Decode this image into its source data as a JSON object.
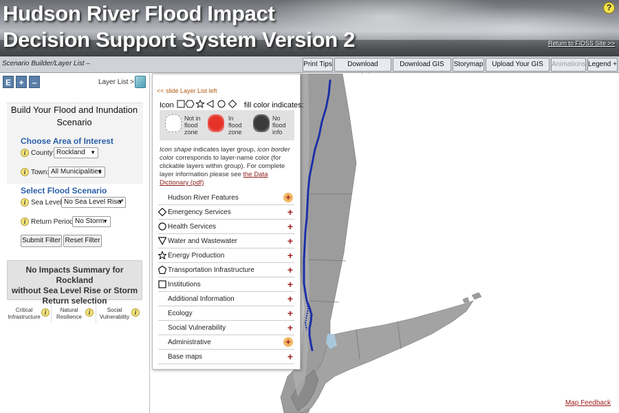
{
  "header": {
    "title_line1": "Hudson River Flood Impact",
    "title_line2": "Decision Support System Version 2",
    "return_link": "Return to FIDSS Site >>",
    "help_icon": "?"
  },
  "toolbar": {
    "scenario_toggle": "Scenario Builder/Layer List –",
    "buttons": [
      "Print Tips",
      "Download Statistics",
      "Download GIS Data",
      "Storymap",
      "Upload Your GIS Data",
      "Animations"
    ],
    "legend": "Legend +"
  },
  "left_panel": {
    "ctrl_buttons": [
      "E",
      "+",
      "–"
    ],
    "layer_list_link": "Layer List >>",
    "build_title_line1": "Build Your Flood and Inundation",
    "build_title_line2": "Scenario",
    "area_head": "Choose Area of Interest",
    "county_label": "County:",
    "county_value": "Rockland",
    "town_label": "Town:",
    "town_value": "All Municipalities",
    "flood_head": "Select Flood Scenario",
    "sea_level_label": "Sea Level:",
    "sea_level_value": "No Sea Level Rise*",
    "return_period_label": "Return Period:",
    "return_period_value": "No Storm",
    "submit_label": "Submit Filter",
    "reset_label": "Reset Filter",
    "summary_line1": "No Impacts Summary for Rockland",
    "summary_line2": "without Sea Level Rise or Storm",
    "summary_line3": "Return selection",
    "summary_tabs": [
      {
        "line1": "Critical",
        "line2": "Infrastructure"
      },
      {
        "line1": "Natural",
        "line2": "Resilience"
      },
      {
        "line1": "Social",
        "line2": "Vulnerability"
      }
    ]
  },
  "layer_panel": {
    "slide_link": "<< slide Layer List left",
    "icon_label": "Icon",
    "fill_label": "fill color indicates:",
    "legend_items": [
      {
        "line1": "Not in",
        "line2": "flood",
        "line3": "zone",
        "color": "#ffffff"
      },
      {
        "line1": "In",
        "line2": "flood",
        "line3": "zone",
        "color": "#e5332a"
      },
      {
        "line1": "No",
        "line2": "flood",
        "line3": "info",
        "color": "#3a3a3a"
      }
    ],
    "desc_part1": "Icon shape",
    "desc_part2": " indicates layer group, ",
    "desc_part3": "icon border color",
    "desc_part4": " corresponds to layer-name color (for clickable layers within group). For complete layer information please see ",
    "desc_link": "the Data Dictionary (pdf)",
    "layers": [
      {
        "label": "Hudson River Features",
        "shape": "none",
        "glow": true
      },
      {
        "label": "Emergency Services",
        "shape": "diamond",
        "glow": false
      },
      {
        "label": "Health Services",
        "shape": "circle",
        "glow": false
      },
      {
        "label": "Water and Wastewater",
        "shape": "triangle-down",
        "glow": false
      },
      {
        "label": "Energy Production",
        "shape": "star",
        "glow": false
      },
      {
        "label": "Transportation Infrastructure",
        "shape": "pentagon",
        "glow": false
      },
      {
        "label": "Institutions",
        "shape": "square",
        "glow": false
      },
      {
        "label": "Additional Information",
        "shape": "none",
        "glow": false
      },
      {
        "label": "Ecology",
        "shape": "none",
        "glow": false
      },
      {
        "label": "Social Vulnerability",
        "shape": "none",
        "glow": false
      },
      {
        "label": "Administrative",
        "shape": "none",
        "glow": true
      },
      {
        "label": "Base maps",
        "shape": "none",
        "glow": false
      }
    ],
    "plus_symbol": "+"
  },
  "map": {
    "feedback_link": "Map Feedback",
    "land_color": "#9c9c9c",
    "river_color": "#1a2fa8"
  },
  "colors": {
    "accent_blue": "#2a5ea8",
    "link_red": "#a01e1e",
    "plus_red": "#a31f1f"
  }
}
